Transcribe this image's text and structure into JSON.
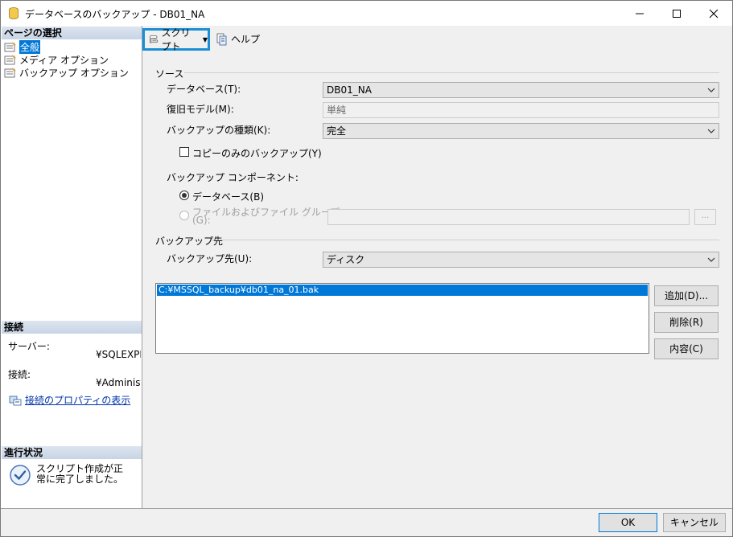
{
  "window": {
    "title": "データベースのバックアップ - DB01_NA"
  },
  "left": {
    "pages_header": "ページの選択",
    "pages": [
      {
        "label": "全般",
        "selected": true
      },
      {
        "label": "メディア オプション",
        "selected": false
      },
      {
        "label": "バックアップ オプション",
        "selected": false
      }
    ],
    "connection_header": "接続",
    "server_label": "サーバー:",
    "server_value": "¥SQLEXPR",
    "conn_label": "接続:",
    "conn_value": "¥Administra",
    "conn_props_link": "接続のプロパティの表示",
    "progress_header": "進行状況",
    "progress_status": "スクリプト作成が正常に完了しました。"
  },
  "toolbar": {
    "script_label": "スクリプト",
    "help_label": "ヘルプ"
  },
  "source": {
    "group": "ソース",
    "database_label": "データベース(T):",
    "database_value": "DB01_NA",
    "recovery_label": "復旧モデル(M):",
    "recovery_value": "単純",
    "backup_type_label": "バックアップの種類(K):",
    "backup_type_value": "完全",
    "copy_only_label": "コピーのみのバックアップ(Y)",
    "component_label": "バックアップ コンポーネント:",
    "radio_database": "データベース(B)",
    "radio_files_line1": "ファイルおよびファイル グループ",
    "radio_files_line2": "(G):",
    "browse_label": "..."
  },
  "destination": {
    "group": "バックアップ先",
    "dest_label": "バックアップ先(U):",
    "dest_value": "ディスク",
    "paths": [
      "C:¥MSSQL_backup¥db01_na_01.bak"
    ],
    "add_button": "追加(D)...",
    "remove_button": "削除(R)",
    "contents_button": "内容(C)"
  },
  "footer": {
    "ok": "OK",
    "cancel": "キャンセル"
  },
  "colors": {
    "highlight": "#0078d7",
    "script_border": "#1a8fd6",
    "header_band": "#c7d4e5"
  }
}
